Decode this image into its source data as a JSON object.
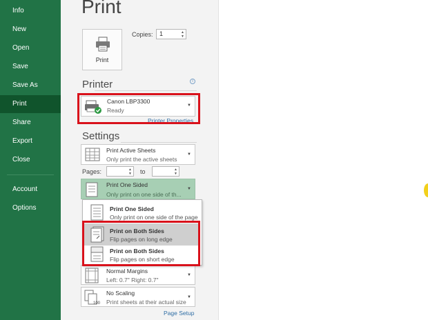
{
  "sidebar": {
    "items": [
      {
        "label": "Info"
      },
      {
        "label": "New"
      },
      {
        "label": "Open"
      },
      {
        "label": "Save"
      },
      {
        "label": "Save As"
      },
      {
        "label": "Print"
      },
      {
        "label": "Share"
      },
      {
        "label": "Export"
      },
      {
        "label": "Close"
      },
      {
        "label": "Account"
      },
      {
        "label": "Options"
      }
    ],
    "active": "Print",
    "color": "#217346"
  },
  "page": {
    "title": "Print"
  },
  "print_button": {
    "label": "Print",
    "icon": "printer-icon"
  },
  "copies": {
    "label": "Copies:",
    "value": "1"
  },
  "printer": {
    "section_title": "Printer",
    "name": "Canon LBP3300",
    "status": "Ready",
    "properties_link": "Printer Properties",
    "icon": "printer-ready-icon"
  },
  "settings": {
    "section_title": "Settings",
    "what": {
      "title": "Print Active Sheets",
      "subtitle": "Only print the active sheets"
    },
    "pages_label": "Pages:",
    "to_label": "to",
    "sides": {
      "title": "Print One Sided",
      "subtitle": "Only print on one side of th..."
    },
    "margins": {
      "title": "Normal Margins",
      "subtitle": "Left: 0.7\"   Right: 0.7\""
    },
    "scaling": {
      "title": "No Scaling",
      "subtitle": "Print sheets at their actual size"
    },
    "page_setup_link": "Page Setup"
  },
  "sides_menu": {
    "options": [
      {
        "title": "Print One Sided",
        "subtitle": "Only print on one side of the page"
      },
      {
        "title": "Print on Both Sides",
        "subtitle": "Flip pages on long edge"
      },
      {
        "title": "Print on Both Sides",
        "subtitle": "Flip pages on short edge"
      }
    ]
  },
  "highlight_color": "#d9111b"
}
